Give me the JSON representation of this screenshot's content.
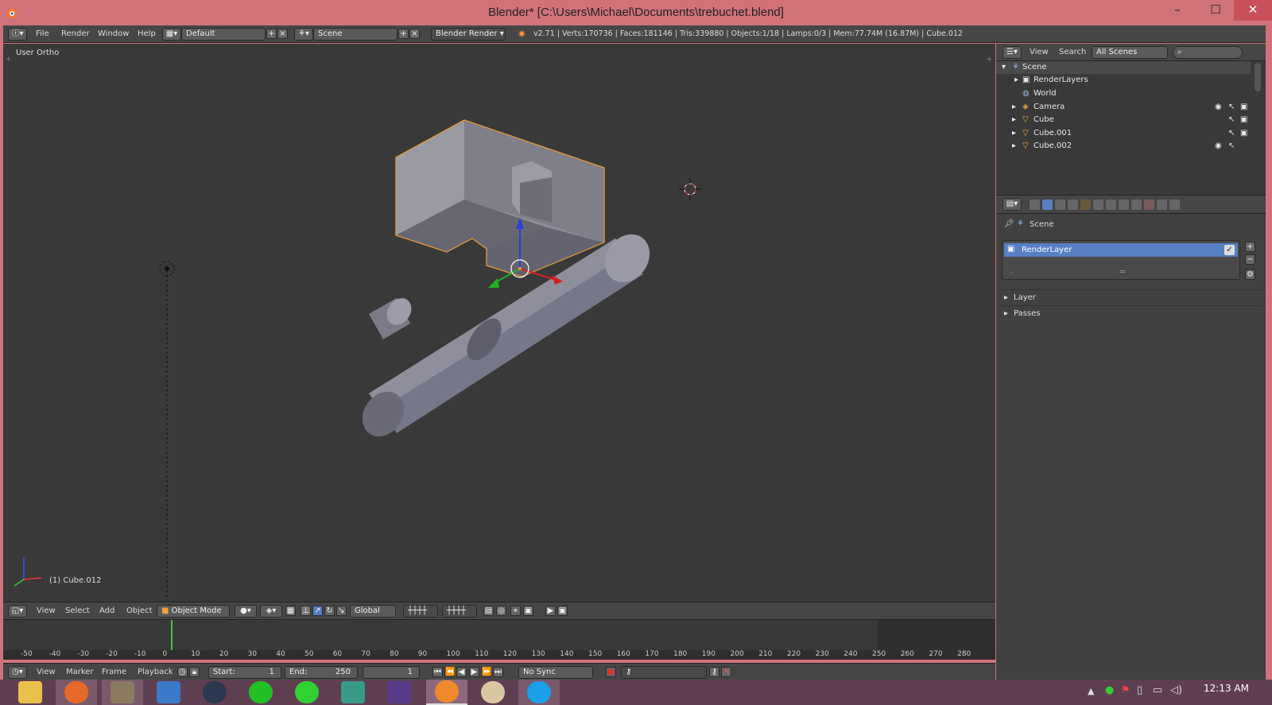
{
  "window": {
    "title": "Blender* [C:\\Users\\Michael\\Documents\\trebuchet.blend]",
    "minimize": "–",
    "maximize": "☐",
    "close": "✕"
  },
  "info_header": {
    "menus": [
      "File",
      "Render",
      "Window",
      "Help"
    ],
    "layout": "Default",
    "scene": "Scene",
    "engine": "Blender Render",
    "stats": "v2.71 | Verts:170736 | Faces:181146 | Tris:339880 | Objects:1/18 | Lamps:0/3 | Mem:77.74M (16.87M) | Cube.012"
  },
  "viewport": {
    "view_label": "User Ortho",
    "object_label": "(1) Cube.012"
  },
  "viewport_header": {
    "menus": [
      "View",
      "Select",
      "Add",
      "Object"
    ],
    "mode": "Object Mode",
    "orientation": "Global"
  },
  "timeline": {
    "ticks": [
      "-50",
      "-40",
      "-30",
      "-20",
      "-10",
      "0",
      "10",
      "20",
      "30",
      "40",
      "50",
      "60",
      "70",
      "80",
      "90",
      "100",
      "110",
      "120",
      "130",
      "140",
      "150",
      "160",
      "170",
      "180",
      "190",
      "200",
      "210",
      "220",
      "230",
      "240",
      "250",
      "260",
      "270",
      "280"
    ],
    "current_frame": 1
  },
  "timeline_header": {
    "menus": [
      "View",
      "Marker",
      "Frame",
      "Playback"
    ],
    "start_label": "Start:",
    "start": "1",
    "end_label": "End:",
    "end": "250",
    "frame": "1",
    "sync": "No Sync"
  },
  "outliner": {
    "menus": [
      "View",
      "Search"
    ],
    "filter": "All Scenes",
    "items": [
      {
        "label": "Scene",
        "icon": "scene-icon"
      },
      {
        "label": "RenderLayers",
        "icon": "renderlayers-icon"
      },
      {
        "label": "World",
        "icon": "world-icon"
      },
      {
        "label": "Camera",
        "icon": "camera-icon"
      },
      {
        "label": "Cube",
        "icon": "mesh-icon"
      },
      {
        "label": "Cube.001",
        "icon": "mesh-icon"
      },
      {
        "label": "Cube.002",
        "icon": "mesh-icon"
      }
    ]
  },
  "properties": {
    "context": "Scene",
    "layer_item": "RenderLayer",
    "panels": [
      "Layer",
      "Passes"
    ]
  },
  "taskbar": {
    "apps": [
      "file-explorer",
      "firefox",
      "gimp",
      "visual-studio-tool",
      "steam",
      "app-green-1",
      "app-green-2",
      "app-document",
      "visual-studio",
      "blender",
      "paint",
      "skype"
    ],
    "time": "12:13 AM"
  },
  "colors": {
    "selection_orange": "#e8993a",
    "highlight_blue": "#5680c2",
    "title_pink": "#d1727a"
  }
}
